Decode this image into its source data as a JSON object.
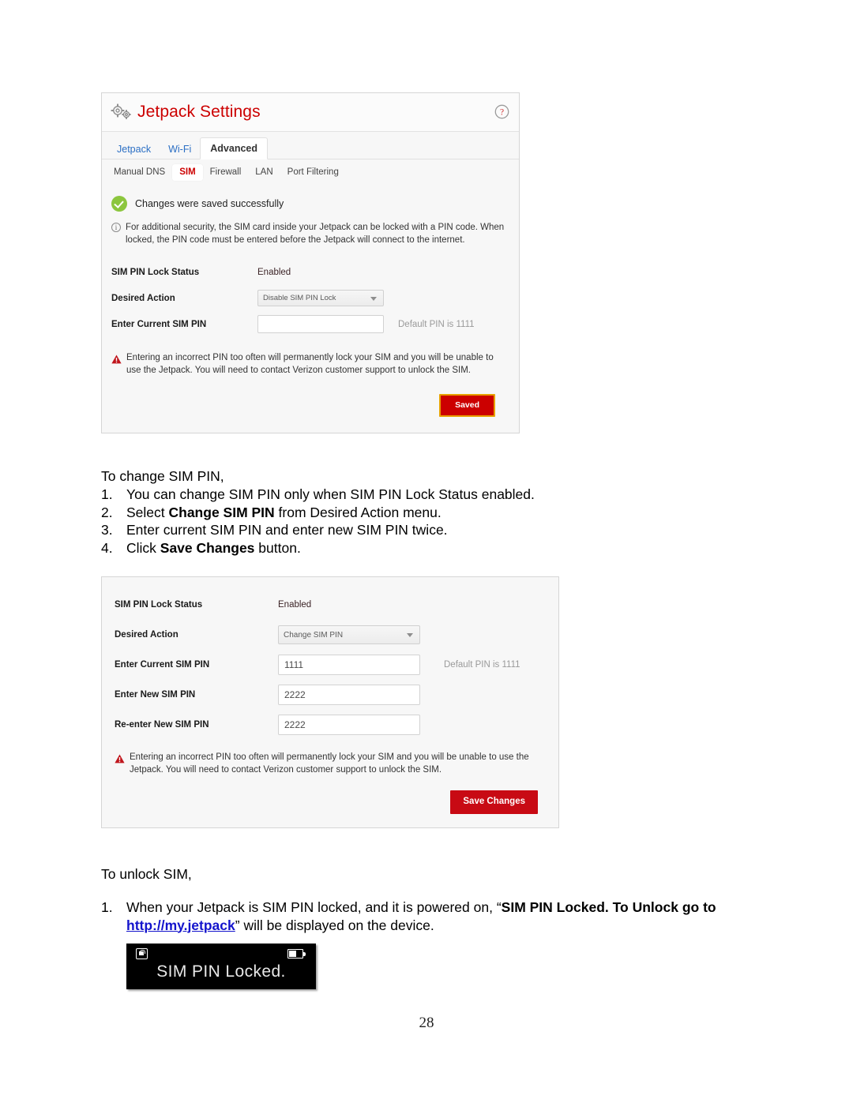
{
  "settings_panel": {
    "header": {
      "title": "Jetpack Settings",
      "gear_icon": "gears-icon",
      "help_icon": "help-question-icon"
    },
    "primary_tabs": [
      {
        "label": "Jetpack",
        "active": false
      },
      {
        "label": "Wi-Fi",
        "active": false
      },
      {
        "label": "Advanced",
        "active": true
      }
    ],
    "secondary_tabs": [
      {
        "label": "Manual DNS",
        "active": false
      },
      {
        "label": "SIM",
        "active": true
      },
      {
        "label": "Firewall",
        "active": false
      },
      {
        "label": "LAN",
        "active": false
      },
      {
        "label": "Port Filtering",
        "active": false
      }
    ],
    "success_message": "Changes were saved successfully",
    "info_message": "For additional security, the SIM card inside your Jetpack can be locked with a PIN code. When locked, the PIN code must be entered before the Jetpack will connect to the internet.",
    "fields": {
      "status_label": "SIM PIN Lock Status",
      "status_value": "Enabled",
      "action_label": "Desired Action",
      "action_value": "Disable SIM PIN Lock",
      "current_pin_label": "Enter Current SIM PIN",
      "current_pin_value": "",
      "hint": "Default PIN is 1111"
    },
    "warning_message": "Entering an incorrect PIN too often will permanently lock your SIM and you will be unable to use the Jetpack. You will need to contact Verizon customer support to unlock the SIM.",
    "button_label": "Saved",
    "colors": {
      "brand_red": "#cc0000",
      "button_border": "#e8a000",
      "success_green": "#8cc63e",
      "link_blue": "#2b6fc4"
    }
  },
  "change_pin_instructions": {
    "intro": "To change SIM PIN,",
    "items": [
      {
        "num": "1.",
        "pre": "You can change SIM PIN only when SIM PIN Lock Status enabled.",
        "bold": "",
        "post": ""
      },
      {
        "num": "2.",
        "pre": "Select ",
        "bold": "Change SIM PIN",
        "post": " from Desired Action menu."
      },
      {
        "num": "3.",
        "pre": "Enter current SIM PIN and enter new SIM PIN twice.",
        "bold": "",
        "post": ""
      },
      {
        "num": "4.",
        "pre": "Click ",
        "bold": "Save Changes",
        "post": " button."
      }
    ]
  },
  "change_pin_panel": {
    "fields": {
      "status_label": "SIM PIN Lock Status",
      "status_value": "Enabled",
      "action_label": "Desired Action",
      "action_value": "Change SIM PIN",
      "current_pin_label": "Enter Current SIM PIN",
      "current_pin_value": "1111",
      "new_pin_label": "Enter New SIM PIN",
      "new_pin_value": "2222",
      "reenter_pin_label": "Re-enter New SIM PIN",
      "reenter_pin_value": "2222",
      "hint": "Default PIN is 1111"
    },
    "warning_message": "Entering an incorrect PIN too often will permanently lock your SIM and you will be unable to use the Jetpack. You will need to contact Verizon customer support to unlock the SIM.",
    "button_label": "Save Changes"
  },
  "unlock_instructions": {
    "intro": "To unlock SIM,",
    "item_num": "1.",
    "line1_pre": "When your Jetpack is SIM PIN locked, and it is powered on, “",
    "line1_bold": "SIM PIN Locked. To Unlock",
    "line2_bold": "go to ",
    "line2_link": "http://my.jetpack",
    "line2_post": "” will be displayed on the device."
  },
  "device_display": {
    "message": "SIM PIN Locked.",
    "lock_icon": "lock-icon",
    "battery_icon": "battery-icon"
  },
  "page_number": "28"
}
